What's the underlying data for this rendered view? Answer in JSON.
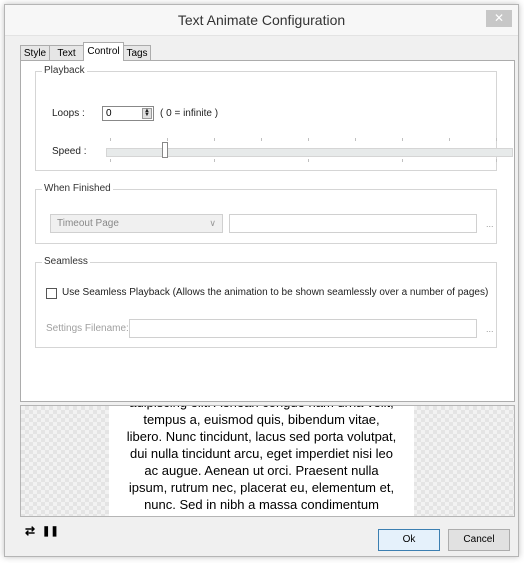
{
  "dialog": {
    "title": "Text Animate Configuration",
    "close_glyph": "✕"
  },
  "tabs": [
    {
      "label": "Style"
    },
    {
      "label": "Text"
    },
    {
      "label": "Control",
      "active": true
    },
    {
      "label": "Tags"
    }
  ],
  "playback": {
    "group_label": "Playback",
    "loops_label": "Loops :",
    "loops_value": "0",
    "loops_hint": "( 0 = infinite )",
    "speed_label": "Speed :",
    "speed_level_fraction": 0.14
  },
  "when_finished": {
    "group_label": "When Finished",
    "selected": "Timeout Page",
    "value": "",
    "browse_label": "..."
  },
  "seamless": {
    "group_label": "Seamless",
    "checkbox_label": "Use Seamless Playback (Allows the animation to be shown seamlessly over a number of pages)",
    "checked": false,
    "filename_label": "Settings Filename:",
    "filename_value": "",
    "browse_label": "..."
  },
  "preview": {
    "text": "adipiscing elit. Aenean congue nam urna velit,\ntempus a, euismod quis, bibendum vitae,\nlibero. Nunc tincidunt, lacus sed porta volutpat,\ndui nulla tincidunt arcu, eget imperdiet nisi leo\nac augue. Aenean ut orci. Praesent nulla\nipsum, rutrum nec, placerat eu, elementum et,\nnunc. Sed in nibh a massa condimentum\nfermentum. Nulla ac massa sit amet quam"
  },
  "controls": {
    "loop_icon": "⇄",
    "pause_icon": "❚❚"
  },
  "buttons": {
    "ok": "Ok",
    "cancel": "Cancel"
  },
  "colors": {
    "dialog_bg": "#f0f0f0",
    "ok_border": "#3c7fb1"
  }
}
